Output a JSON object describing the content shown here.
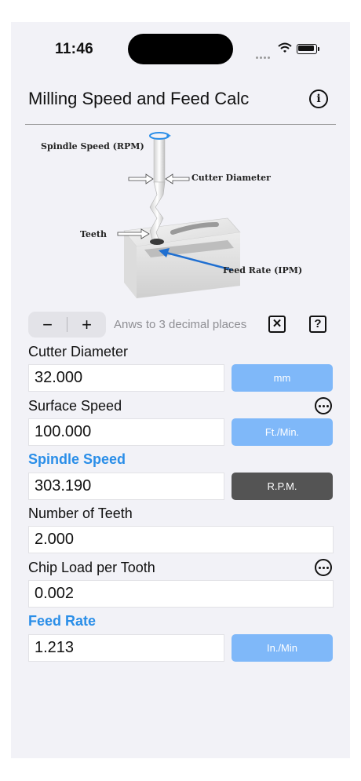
{
  "status_bar": {
    "time": "11:46"
  },
  "header": {
    "title": "Milling Speed and Feed Calc"
  },
  "diagram": {
    "spindle_speed_label": "Spindle Speed (RPM)",
    "cutter_diameter_label": "Cutter Diameter",
    "teeth_label": "Teeth",
    "feed_rate_label": "Feed Rate (IPM)"
  },
  "precision": {
    "minus": "−",
    "plus": "+",
    "text": "Anws to 3 decimal places",
    "clear_glyph": "✕",
    "help_glyph": "?"
  },
  "fields": {
    "cutter_diameter": {
      "label": "Cutter Diameter",
      "value": "32.000",
      "unit": "mm"
    },
    "surface_speed": {
      "label": "Surface Speed",
      "value": "100.000",
      "unit": "Ft./Min."
    },
    "spindle_speed": {
      "label": "Spindle Speed",
      "value": "303.190",
      "unit": "R.P.M."
    },
    "number_of_teeth": {
      "label": "Number of Teeth",
      "value": "2.000"
    },
    "chip_load": {
      "label": "Chip Load per Tooth",
      "value": "0.002"
    },
    "feed_rate": {
      "label": "Feed Rate",
      "value": "1.213",
      "unit": "In./Min"
    }
  },
  "colors": {
    "accent": "#2a8ee8",
    "unit_button": "#7fb8f9",
    "result_unit_button": "#545454",
    "background": "#f2f2f7"
  }
}
